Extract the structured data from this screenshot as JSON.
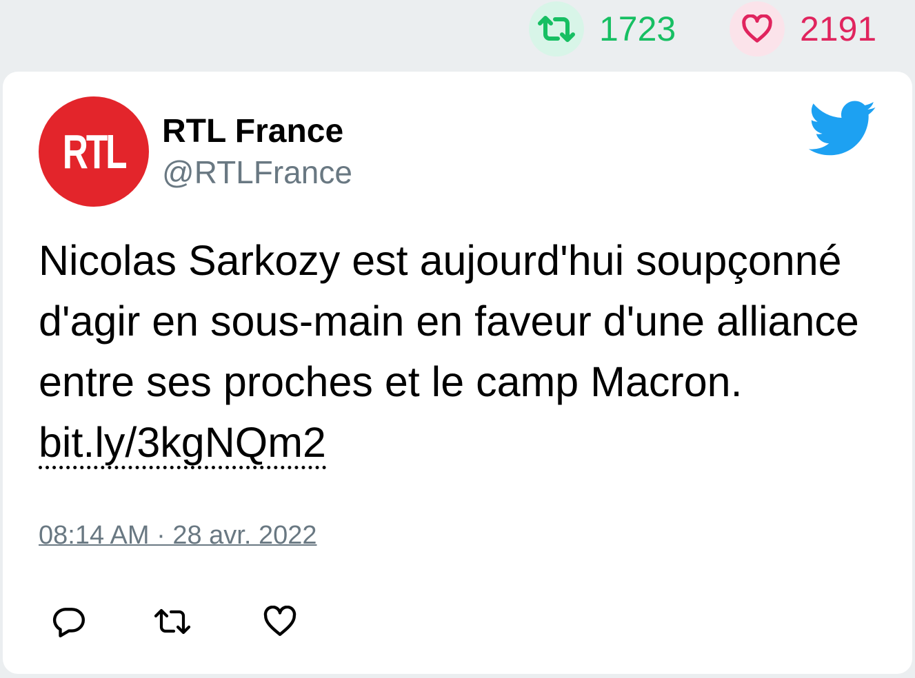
{
  "stats": {
    "retweet_count": "1723",
    "like_count": "2191",
    "retweet_color": "#17bf63",
    "like_color": "#e0245e"
  },
  "tweet": {
    "author_name": "RTL France",
    "author_handle": "@RTLFrance",
    "avatar_logo_text": "RTL",
    "text_before_link": "Nicolas Sarkozy est aujourd'hui soupçonné d'agir en sous-main en faveur d'une alliance entre ses proches et le camp Macron. ",
    "link_text": "bit.ly/3kgNQm2",
    "timestamp": "08:14 AM · 28 avr. 2022"
  },
  "icons": {
    "stats_retweet": "retweet-icon",
    "stats_like": "heart-icon",
    "brand": "twitter-bird-icon",
    "actions": [
      "reply-icon",
      "retweet-icon",
      "like-icon"
    ]
  }
}
